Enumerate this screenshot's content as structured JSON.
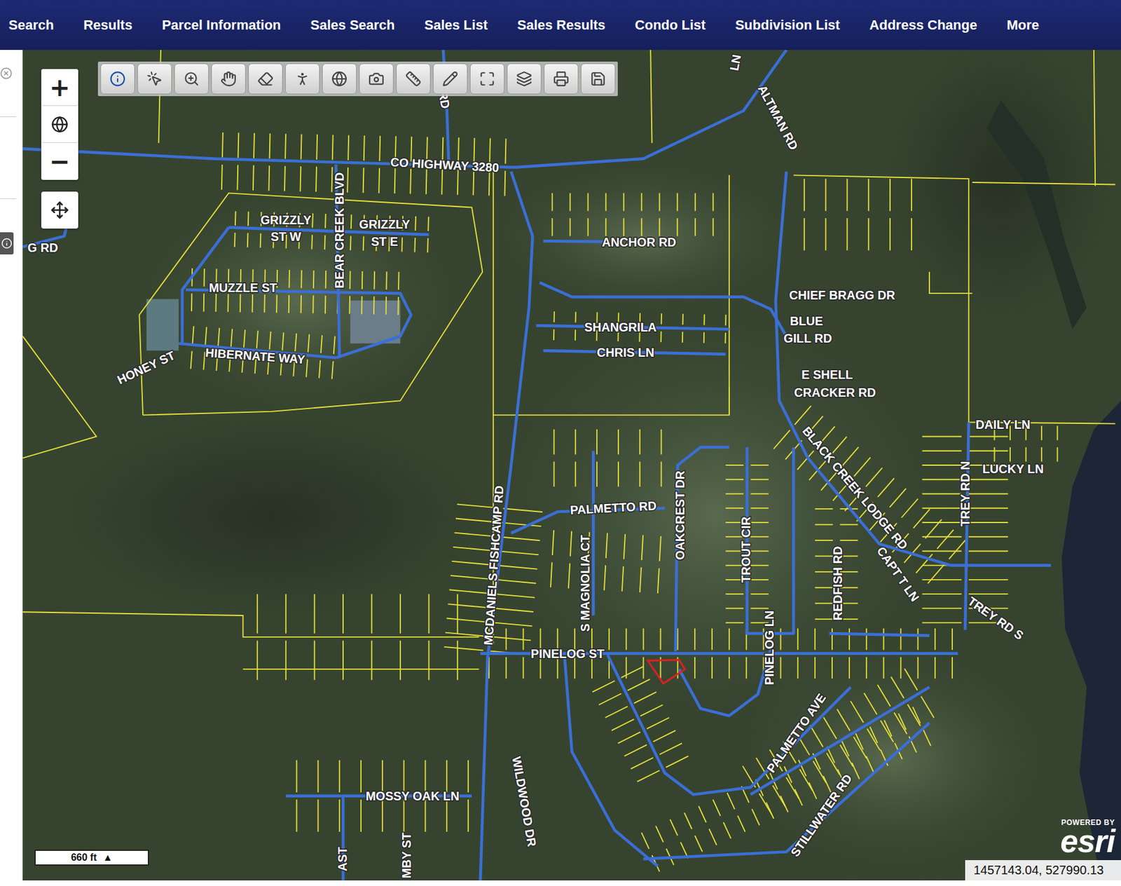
{
  "nav": [
    {
      "label": "Search"
    },
    {
      "label": "Results"
    },
    {
      "label": "Parcel Information"
    },
    {
      "label": "Sales Search"
    },
    {
      "label": "Sales List"
    },
    {
      "label": "Sales Results"
    },
    {
      "label": "Condo List"
    },
    {
      "label": "Subdivision List"
    },
    {
      "label": "Address Change"
    },
    {
      "label": "More"
    }
  ],
  "zoom_controls": {
    "zoom_in": "+",
    "zoom_out": "−"
  },
  "map": {
    "labels": [
      {
        "text": "CO HIGHWAY 3280"
      },
      {
        "text": "ANCHOR RD"
      },
      {
        "text": "ALTMAN RD"
      },
      {
        "text": "CHIEF BRAGG DR"
      },
      {
        "text": "BLUE"
      },
      {
        "text": "GILL RD"
      },
      {
        "text": "E SHELL"
      },
      {
        "text": "CRACKER RD"
      },
      {
        "text": "SHANGRILA"
      },
      {
        "text": "CHRIS LN"
      },
      {
        "text": "GRIZZLY"
      },
      {
        "text": "ST W"
      },
      {
        "text": "GRIZZLY"
      },
      {
        "text": "ST E"
      },
      {
        "text": "BEAR CREEK BLVD"
      },
      {
        "text": "MUZZLE ST"
      },
      {
        "text": "HIBERNATE WAY"
      },
      {
        "text": "HONEY ST"
      },
      {
        "text": "G RD"
      },
      {
        "text": "DAILY LN"
      },
      {
        "text": "LUCKY LN"
      },
      {
        "text": "TREY RD N"
      },
      {
        "text": "BLACK CREEK LODGE RD"
      },
      {
        "text": "CAPT T LN"
      },
      {
        "text": "TREY RD S"
      },
      {
        "text": "PALMETTO RD"
      },
      {
        "text": "OAKCREST DR"
      },
      {
        "text": "S MAGNOLIA CT"
      },
      {
        "text": "MCDANIELS FISHCAMP RD"
      },
      {
        "text": "TROUT CIR"
      },
      {
        "text": "REDFISH RD"
      },
      {
        "text": "PINELOG ST"
      },
      {
        "text": "PINELOG LN"
      },
      {
        "text": "PALMETTO AVE"
      },
      {
        "text": "STILLWATER RD"
      },
      {
        "text": "WILDWOOD DR"
      },
      {
        "text": "MOSSY OAK LN"
      },
      {
        "text": "AST"
      },
      {
        "text": "MBY ST"
      },
      {
        "text": "RD"
      },
      {
        "text": "LN"
      }
    ],
    "selected_parcel": {
      "selected": true,
      "color": "#e02020"
    },
    "scale_bar": {
      "label": "660 ft",
      "arrow": "▲"
    },
    "coordinates": "1457143.04, 527990.13",
    "attribution": {
      "powered_by": "POWERED BY",
      "logo": "esri"
    }
  }
}
